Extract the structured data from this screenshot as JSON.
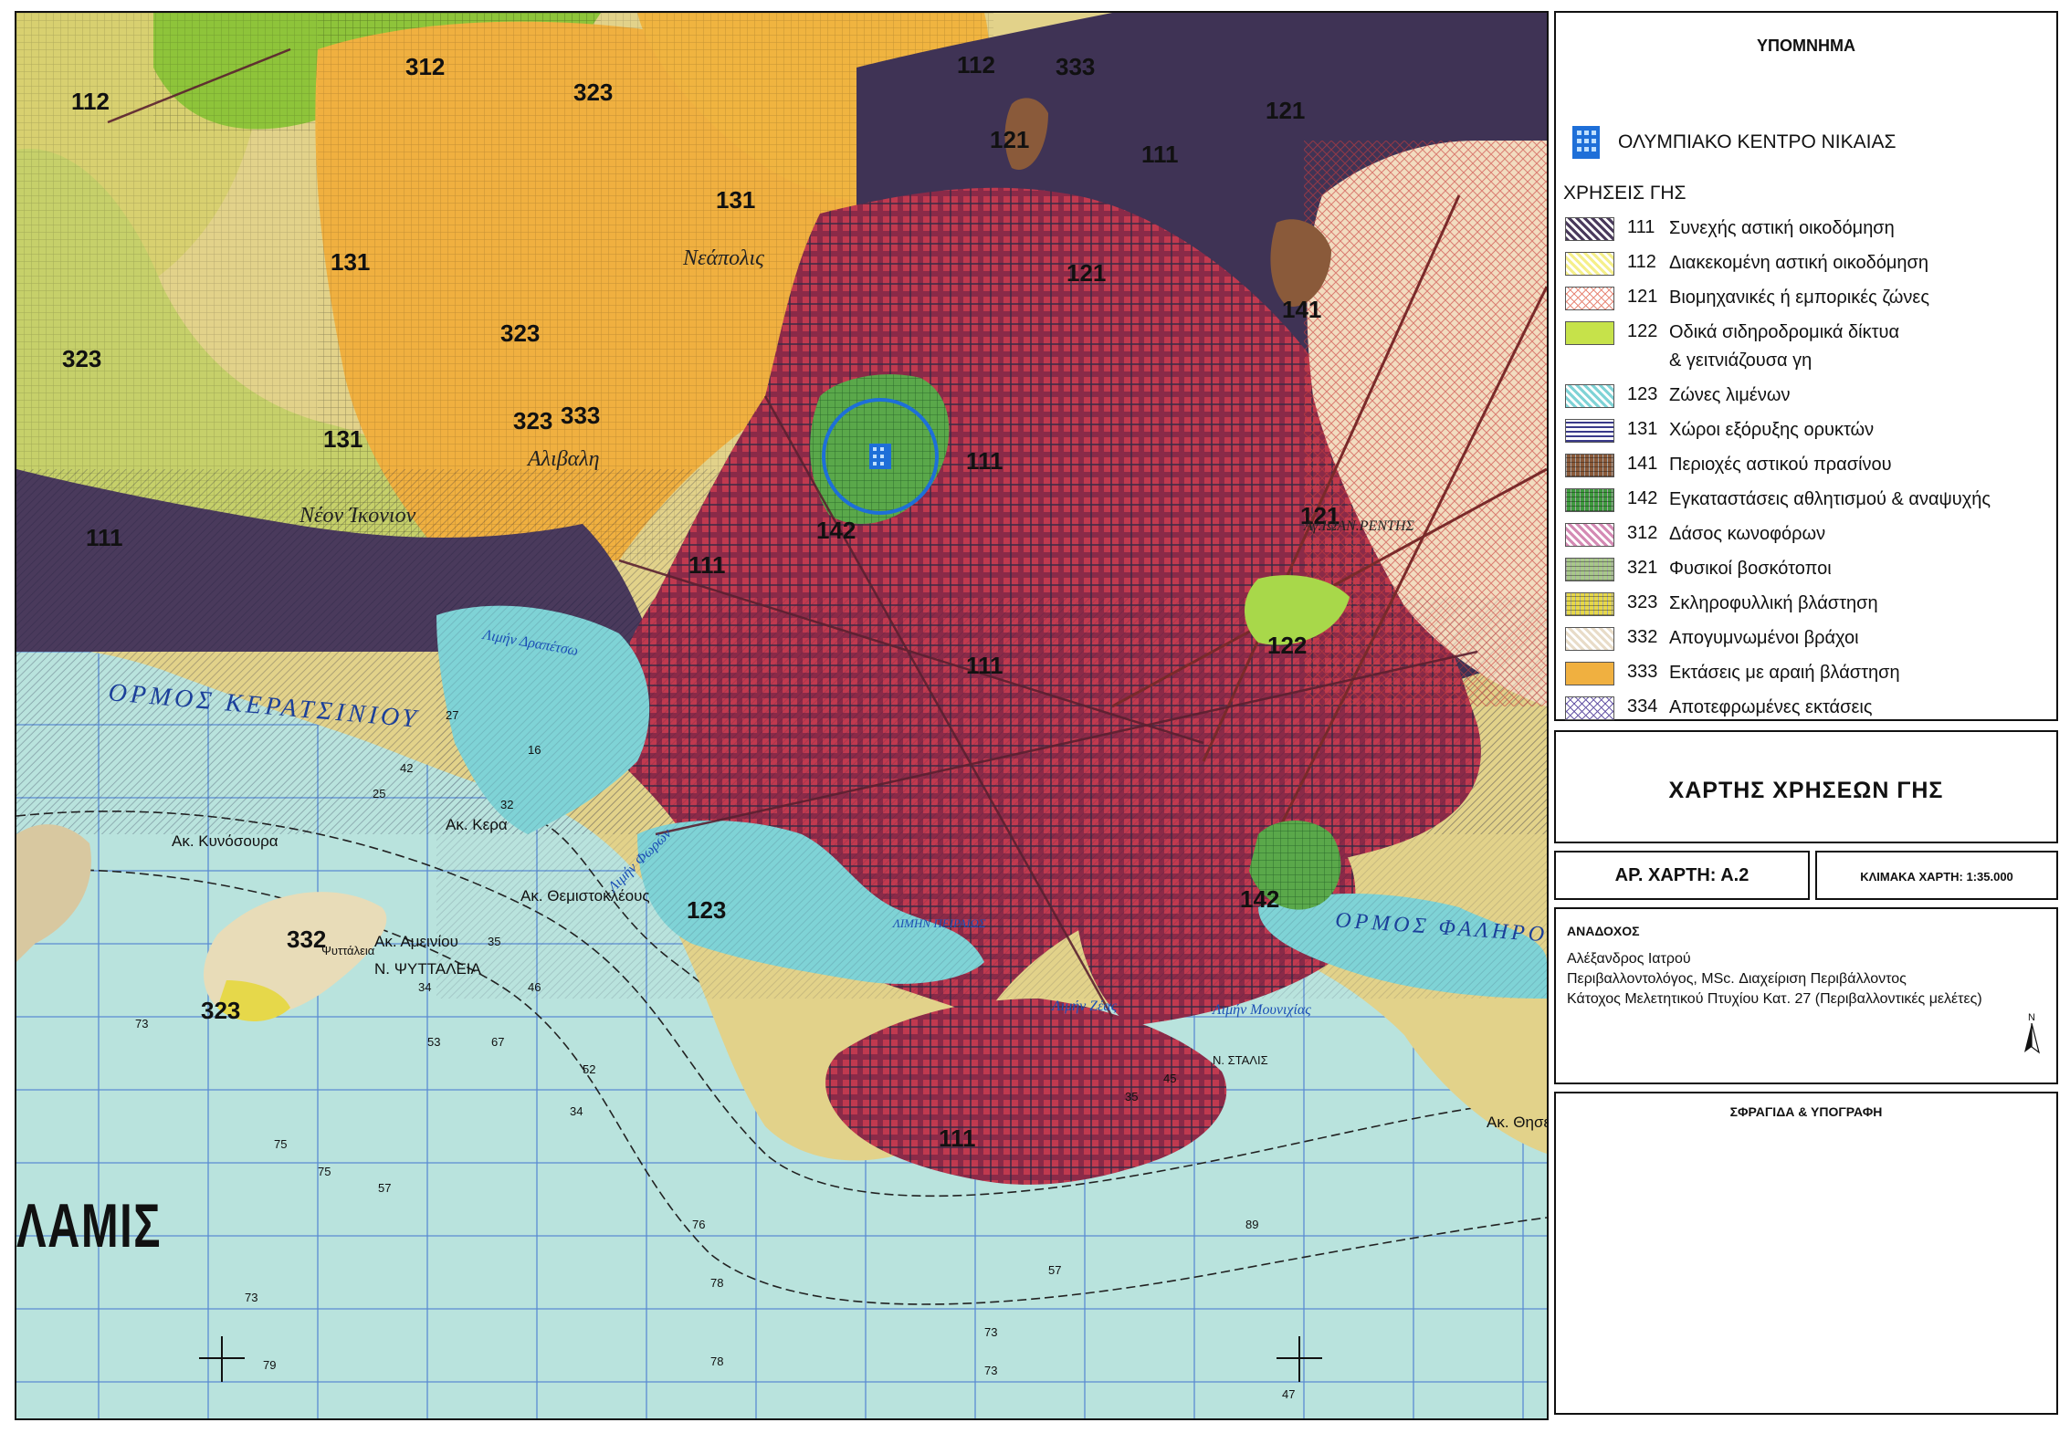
{
  "map": {
    "site_marker_icon": "sports-centre-building-icon",
    "zone_labels": [
      "112",
      "312",
      "323",
      "112",
      "333",
      "121",
      "121",
      "131",
      "111",
      "121",
      "131",
      "323",
      "323",
      "141",
      "323",
      "333",
      "131",
      "142",
      "111",
      "111",
      "121",
      "111",
      "122",
      "111",
      "123",
      "142",
      "332",
      "323",
      "111"
    ],
    "places": [
      "Νεάπολις",
      "Νέον Ίκονιον",
      "Αλιβαλη",
      "Αγ.ΙΩΑΝ.ΡΕΝΤΗΣ"
    ],
    "sea_names": [
      "ΟΡΜΟΣ  ΚΕΡΑΤΣΙΝΙΟΥ",
      "ΟΡΜΟΣ  ΦΑΛΗΡΟΥ"
    ],
    "capes": [
      "Ακ. Κυνόσουρα",
      "Ακ. Κερα",
      "Ακ. Θεμιστοκλέους",
      "Ακ. Αμεινίου",
      "Ν. ΨΥΤΤΑΛΕΙΑ",
      "Ψυττάλεια",
      "Ακ. Θησέω",
      "Ν. ΣΤΑΛΙΣ"
    ],
    "harbors": [
      "Λιμήν Δραπέτσω",
      "Λιμήν Φωρών",
      "ΛΙΜΗΝ ΠΕΙΡΑΙΩΣ",
      "Λιμήν Ζέας",
      "Λιμήν Μουνιχίας"
    ],
    "island_name": "ΛΑΜΙΣ",
    "depths": [
      "27",
      "42",
      "16",
      "32",
      "25",
      "34",
      "35",
      "46",
      "73",
      "53",
      "67",
      "75",
      "75",
      "57",
      "52",
      "34",
      "79",
      "73",
      "78",
      "78",
      "76",
      "73",
      "73",
      "89",
      "57",
      "47",
      "45",
      "35"
    ]
  },
  "legend": {
    "title": "ΥΠΟΜΝΗΜΑ",
    "site_label": "ΟΛΥΜΠΙΑΚΟ ΚΕΝΤΡΟ ΝΙΚΑΙΑΣ",
    "land_use_heading": "ΧΡΗΣΕΙΣ ΓΗΣ",
    "items": [
      {
        "code": "111",
        "name": "Συνεχής αστική οικοδόμηση",
        "color": "#4a3a5c",
        "pattern": "hatch"
      },
      {
        "code": "112",
        "name": "Διακεκομένη αστική οικοδόμηση",
        "color": "#f5ef8a",
        "pattern": "hatch"
      },
      {
        "code": "121",
        "name": "Βιομηχανικές ή εμπορικές ζώνες",
        "color": "#e88a7a",
        "pattern": "cross"
      },
      {
        "code": "122",
        "name": "Οδικά σιδηροδρομικά δίκτυα\n& γειτνιάζουσα γη",
        "color": "#c6e24a",
        "pattern": "solid"
      },
      {
        "code": "123",
        "name": "Ζώνες λιμένων",
        "color": "#7fd3d6",
        "pattern": "hatch"
      },
      {
        "code": "131",
        "name": "Χώροι εξόρυξης ορυκτών",
        "color": "#3a3a8a",
        "pattern": "lines"
      },
      {
        "code": "141",
        "name": "Περιοχές αστικού πρασίνου",
        "color": "#8a5a3a",
        "pattern": "grid"
      },
      {
        "code": "142",
        "name": "Εγκαταστάσεις αθλητισμού & αναψυχής",
        "color": "#3f9a3f",
        "pattern": "grid"
      },
      {
        "code": "312",
        "name": "Δάσος κωνοφόρων",
        "color": "#d48ab4",
        "pattern": "hatch"
      },
      {
        "code": "321",
        "name": "Φυσικοί βοσκότοποι",
        "color": "#a8c88a",
        "pattern": "grid"
      },
      {
        "code": "323",
        "name": "Σκληροφυλλική βλάστηση",
        "color": "#e6d84a",
        "pattern": "grid"
      },
      {
        "code": "332",
        "name": "Απογυμνωμένοι βράχοι",
        "color": "#e8dcc8",
        "pattern": "hatch"
      },
      {
        "code": "333",
        "name": "Εκτάσεις με αραιή βλάστηση",
        "color": "#f0b040",
        "pattern": "solid"
      },
      {
        "code": "334",
        "name": "Αποτεφρωμένες εκτάσεις",
        "color": "#6a5aa8",
        "pattern": "cross"
      }
    ]
  },
  "title_block": {
    "map_title": "ΧΑΡΤΗΣ ΧΡΗΣΕΩΝ ΓΗΣ",
    "map_number": "ΑΡ. ΧΑΡΤΗ: Α.2",
    "scale": "ΚΛΙΜΑΚΑ ΧΑΡΤΗ: 1:35.000"
  },
  "contractor": {
    "heading": "ΑΝΑΔΟΧΟΣ",
    "lines": [
      "Αλέξανδρος Ιατρού",
      "Περιβαλλοντολόγος, MSc. Διαχείριση Περιβάλλοντος",
      "Κάτοχος Μελετητικού Πτυχίου Κατ. 27 (Περιβαλλοντικές μελέτες)"
    ],
    "north_label": "N"
  },
  "signature": {
    "heading": "ΣΦΡΑΓΙΔΑ & ΥΠΟΓΡΑΦΗ"
  }
}
